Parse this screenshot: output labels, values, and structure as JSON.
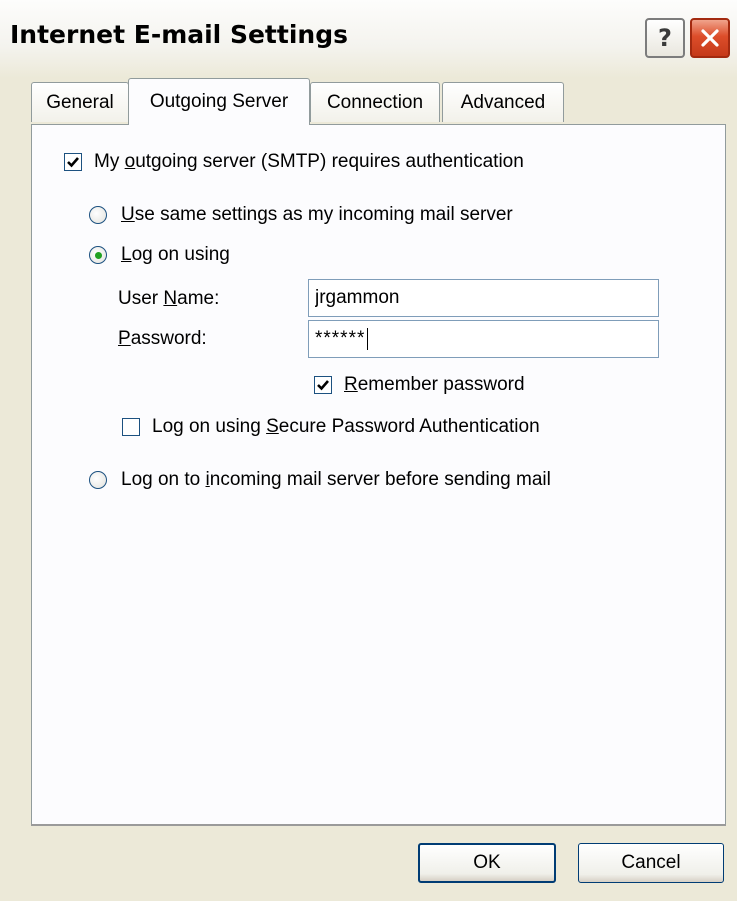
{
  "window": {
    "title": "Internet E-mail Settings",
    "help_label": "?"
  },
  "tabs": [
    {
      "label": "General",
      "active": false
    },
    {
      "label": "Outgoing Server",
      "active": true
    },
    {
      "label": "Connection",
      "active": false
    },
    {
      "label": "Advanced",
      "active": false
    }
  ],
  "auth": {
    "checkbox": {
      "pre": "My ",
      "key": "o",
      "post": "utgoing server (SMTP) requires authentication",
      "checked": true
    },
    "radio_same": {
      "key": "U",
      "post": "se same settings as my incoming mail server",
      "selected": false
    },
    "radio_logon": {
      "key": "L",
      "post": "og on using",
      "selected": true
    },
    "username": {
      "pre": "User ",
      "key": "N",
      "post": "ame:",
      "value": "jrgammon"
    },
    "password": {
      "key": "P",
      "post": "assword:",
      "value": "******"
    },
    "remember": {
      "key": "R",
      "post": "emember password",
      "checked": true
    },
    "spa": {
      "pre": "Log on using ",
      "key": "S",
      "post": "ecure Password Authentication",
      "checked": false
    },
    "radio_incoming": {
      "pre": "Log on to ",
      "key": "i",
      "post": "ncoming mail server before sending mail",
      "selected": false
    }
  },
  "buttons": {
    "ok": "OK",
    "cancel": "Cancel"
  },
  "colors": {
    "dialog_bg": "#ece9d8",
    "panel_bg": "#fcfcfe",
    "close_red": "#dd4d2a",
    "check_mark": "#000000",
    "radio_dot": "#21a121"
  }
}
